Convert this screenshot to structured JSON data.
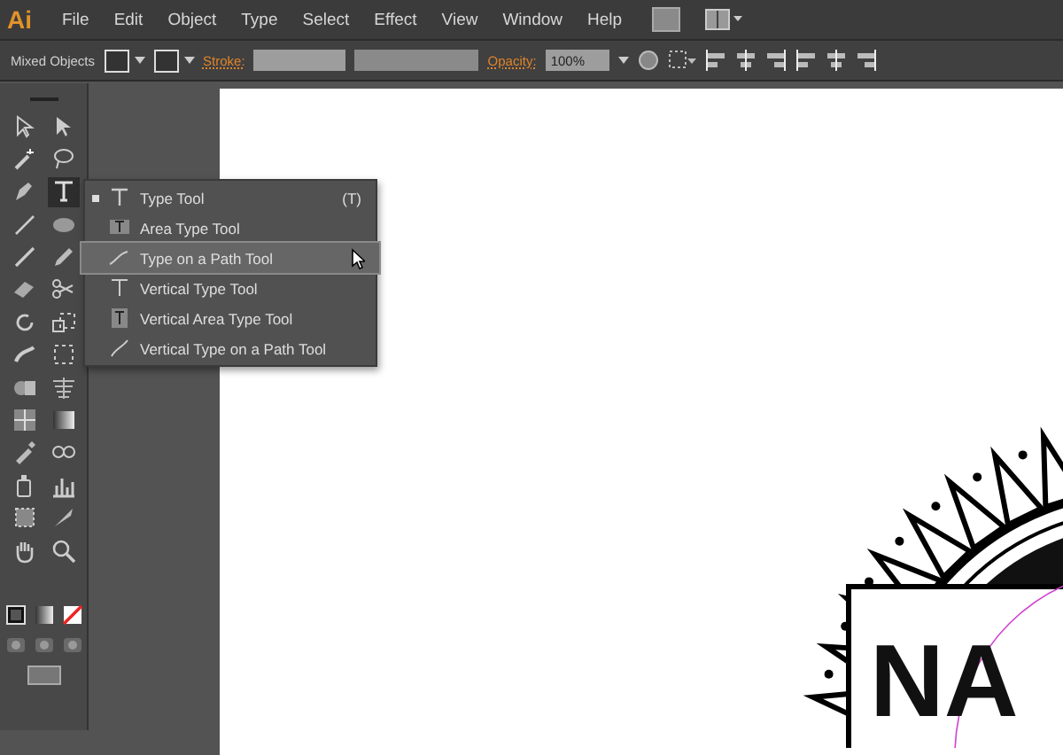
{
  "app": {
    "logo": "Ai"
  },
  "menu": [
    "File",
    "Edit",
    "Object",
    "Type",
    "Select",
    "Effect",
    "View",
    "Window",
    "Help"
  ],
  "control_bar": {
    "selection": "Mixed Objects",
    "stroke_label": "Stroke:",
    "opacity_label": "Opacity:",
    "opacity_value": "100%"
  },
  "tools": [
    {
      "kind": "selection",
      "selected": false
    },
    {
      "kind": "direct",
      "selected": false
    },
    {
      "kind": "wand",
      "selected": false
    },
    {
      "kind": "lasso",
      "selected": false
    },
    {
      "kind": "pen",
      "selected": false
    },
    {
      "kind": "type",
      "selected": true
    },
    {
      "kind": "line",
      "selected": false
    },
    {
      "kind": "ellipse",
      "selected": false
    },
    {
      "kind": "brush",
      "selected": false
    },
    {
      "kind": "pencil",
      "selected": false
    },
    {
      "kind": "eraser",
      "selected": false
    },
    {
      "kind": "scissors",
      "selected": false
    },
    {
      "kind": "rotate",
      "selected": false
    },
    {
      "kind": "scale",
      "selected": false
    },
    {
      "kind": "warp",
      "selected": false
    },
    {
      "kind": "transform",
      "selected": false
    },
    {
      "kind": "shape",
      "selected": false
    },
    {
      "kind": "perspective",
      "selected": false
    },
    {
      "kind": "mesh",
      "selected": false
    },
    {
      "kind": "gradient",
      "selected": false
    },
    {
      "kind": "eyedropper",
      "selected": false
    },
    {
      "kind": "blend",
      "selected": false
    },
    {
      "kind": "spray",
      "selected": false
    },
    {
      "kind": "graph",
      "selected": false
    },
    {
      "kind": "artboard",
      "selected": false
    },
    {
      "kind": "slice",
      "selected": false
    },
    {
      "kind": "hand",
      "selected": false
    },
    {
      "kind": "zoom",
      "selected": false
    }
  ],
  "flyout": [
    {
      "label": "Type Tool",
      "shortcut": "(T)",
      "selected": false,
      "current": true
    },
    {
      "label": "Area Type Tool",
      "selected": false,
      "current": false
    },
    {
      "label": "Type on a Path Tool",
      "selected": true,
      "current": false
    },
    {
      "label": "Vertical Type Tool",
      "selected": false,
      "current": false
    },
    {
      "label": "Vertical Area Type Tool",
      "selected": false,
      "current": false
    },
    {
      "label": "Vertical Type on a Path Tool",
      "selected": false,
      "current": false
    }
  ],
  "artwork": {
    "text": "NA"
  }
}
